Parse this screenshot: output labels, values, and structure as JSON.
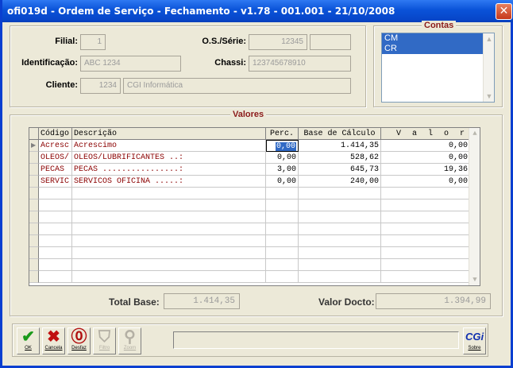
{
  "window": {
    "title": "ofi019d - Ordem de Serviço - Fechamento -  v1.78 - 001.001 - 21/10/2008",
    "close_glyph": "✕"
  },
  "header": {
    "filial_label": "Filial:",
    "filial_value": "1",
    "os_label": "O.S./Série:",
    "os_value": "12345",
    "serie_value": "",
    "identificacao_label": "Identificação:",
    "identificacao_value": "ABC 1234",
    "chassi_label": "Chassi:",
    "chassi_value": "123745678910",
    "cliente_label": "Cliente:",
    "cliente_code": "1234",
    "cliente_name": "CGI Informática"
  },
  "contas": {
    "title": "Contas",
    "items": [
      "CM",
      "CR"
    ]
  },
  "valores": {
    "title": "Valores",
    "columns": {
      "codigo": "Código",
      "descricao": "Descrição",
      "perc": "Perc.",
      "base": "Base de Cálculo",
      "valor": "V a l o r"
    },
    "rows": [
      {
        "codigo": "Acresc",
        "descricao": "Acrescimo",
        "perc": "0,00",
        "base": "1.414,35",
        "valor": "0,00"
      },
      {
        "codigo": "OLEOS/",
        "descricao": "OLEOS/LUBRIFICANTES ..:",
        "perc": "0,00",
        "base": "528,62",
        "valor": "0,00"
      },
      {
        "codigo": "PECAS",
        "descricao": "PECAS ................:",
        "perc": "3,00",
        "base": "645,73",
        "valor": "19,36"
      },
      {
        "codigo": "SERVIC",
        "descricao": "SERVICOS OFICINA .....:",
        "perc": "0,00",
        "base": "240,00",
        "valor": "0,00"
      }
    ]
  },
  "totals": {
    "total_base_label": "Total Base:",
    "total_base_value": "1.414,35",
    "valor_docto_label": "Valor Docto:",
    "valor_docto_value": "1.394,99"
  },
  "toolbar": {
    "ok_label": "OK",
    "cancela_label": "Cancela",
    "desfaz_label": "Desfaz",
    "filtro_label": "Filtro",
    "zoom_label": "Zoom",
    "sobre_label": "Sobre",
    "sobre_logo": "CGi"
  },
  "colors": {
    "titlebar": "#0a52d8",
    "group_title": "#8b1a1a",
    "selection": "#316ac5",
    "grid_text": "#8b0000"
  }
}
